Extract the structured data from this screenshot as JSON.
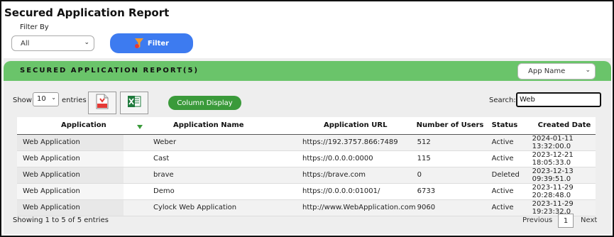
{
  "header": {
    "title": "Secured Application Report"
  },
  "filter": {
    "label": "Filter By",
    "selected": "All",
    "button_label": "Filter"
  },
  "report_bar": {
    "title": "SECURED APPLICATION REPORT(5)",
    "selector": "App Name",
    "color": "#6ac46a"
  },
  "controls": {
    "show_label": "Show",
    "page_size": "10",
    "entries_label": "entries",
    "column_display_label": "Column Display",
    "search_label": "Search:",
    "search_value": "Web"
  },
  "table": {
    "columns": [
      "Application",
      "Application Name",
      "Application URL",
      "Number of Users",
      "Status",
      "Created Date"
    ],
    "rows": [
      [
        "Web Application",
        "Weber",
        "https://192.3757.866:7489",
        "512",
        "Active",
        "2024-01-11 13:32:00.0"
      ],
      [
        "Web Application",
        "Cast",
        "https://0.0.0.0:0000",
        "115",
        "Active",
        "2023-12-21 18:05:33.0"
      ],
      [
        "Web Application",
        "brave",
        "https://brave.com",
        "0",
        "Deleted",
        "2023-12-13 09:39:51.0"
      ],
      [
        "Web Application",
        "Demo",
        "https://0.0.0.0:01001/",
        "6733",
        "Active",
        "2023-11-29 20:28:48.0"
      ],
      [
        "Web Application",
        "Cylock Web Application",
        "http://www.WebApplication.com",
        "9060",
        "Active",
        "2023-11-29 19:23:32.0"
      ]
    ]
  },
  "footer": {
    "info": "Showing 1 to 5 of 5 entries",
    "previous": "Previous",
    "page": "1",
    "next": "Next"
  },
  "colors": {
    "filter_button": "#3d7bf0",
    "column_display_button": "#3a9a3a"
  }
}
